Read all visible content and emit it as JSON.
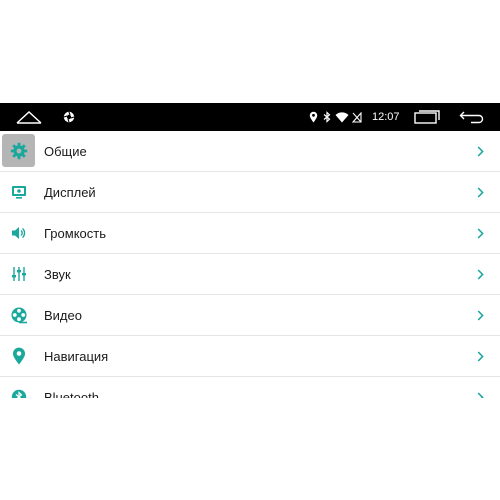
{
  "statusbar": {
    "time": "12:07",
    "icons": [
      "home-icon",
      "camera-aperture-icon",
      "location-icon",
      "bluetooth-icon",
      "wifi-icon",
      "no-sim-icon",
      "recent-apps-icon",
      "back-icon"
    ]
  },
  "colors": {
    "accent": "#1aa89c",
    "chevron": "#1aa89c",
    "statusbar_bg": "#000000"
  },
  "settings": {
    "items": [
      {
        "label": "Общие",
        "icon": "gear-icon",
        "selected": true
      },
      {
        "label": "Дисплей",
        "icon": "display-icon",
        "selected": false
      },
      {
        "label": "Громкость",
        "icon": "speaker-icon",
        "selected": false
      },
      {
        "label": "Звук",
        "icon": "equalizer-icon",
        "selected": false
      },
      {
        "label": "Видео",
        "icon": "film-reel-icon",
        "selected": false
      },
      {
        "label": "Навигация",
        "icon": "location-pin-icon",
        "selected": false
      },
      {
        "label": "Bluetooth",
        "icon": "bluetooth-icon",
        "selected": false
      }
    ]
  }
}
